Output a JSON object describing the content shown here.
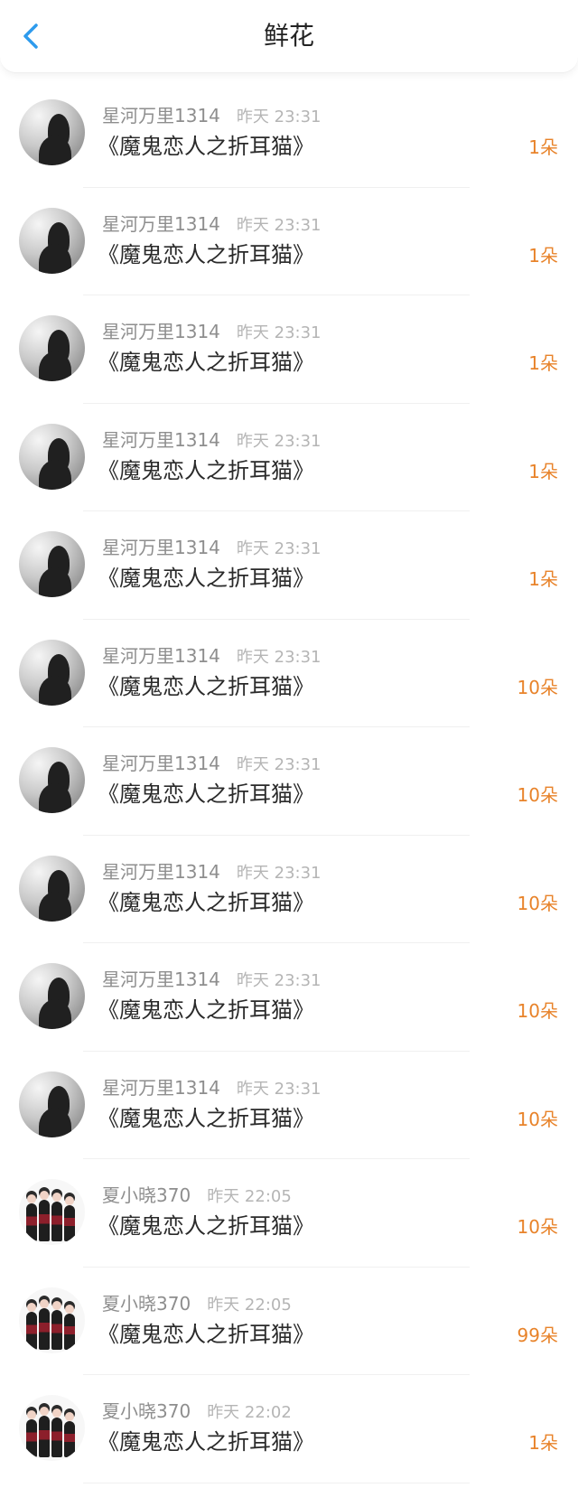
{
  "header": {
    "title": "鲜花",
    "back_icon": "chevron-left-icon",
    "accent_color": "#2e9bed"
  },
  "items": [
    {
      "username": "星河万里1314",
      "time": "昨天 23:31",
      "book": "《魔鬼恋人之折耳猫》",
      "count": "1朵",
      "avatar": "avatar-a"
    },
    {
      "username": "星河万里1314",
      "time": "昨天 23:31",
      "book": "《魔鬼恋人之折耳猫》",
      "count": "1朵",
      "avatar": "avatar-a"
    },
    {
      "username": "星河万里1314",
      "time": "昨天 23:31",
      "book": "《魔鬼恋人之折耳猫》",
      "count": "1朵",
      "avatar": "avatar-a"
    },
    {
      "username": "星河万里1314",
      "time": "昨天 23:31",
      "book": "《魔鬼恋人之折耳猫》",
      "count": "1朵",
      "avatar": "avatar-a"
    },
    {
      "username": "星河万里1314",
      "time": "昨天 23:31",
      "book": "《魔鬼恋人之折耳猫》",
      "count": "1朵",
      "avatar": "avatar-a"
    },
    {
      "username": "星河万里1314",
      "time": "昨天 23:31",
      "book": "《魔鬼恋人之折耳猫》",
      "count": "10朵",
      "avatar": "avatar-a"
    },
    {
      "username": "星河万里1314",
      "time": "昨天 23:31",
      "book": "《魔鬼恋人之折耳猫》",
      "count": "10朵",
      "avatar": "avatar-a"
    },
    {
      "username": "星河万里1314",
      "time": "昨天 23:31",
      "book": "《魔鬼恋人之折耳猫》",
      "count": "10朵",
      "avatar": "avatar-a"
    },
    {
      "username": "星河万里1314",
      "time": "昨天 23:31",
      "book": "《魔鬼恋人之折耳猫》",
      "count": "10朵",
      "avatar": "avatar-a"
    },
    {
      "username": "星河万里1314",
      "time": "昨天 23:31",
      "book": "《魔鬼恋人之折耳猫》",
      "count": "10朵",
      "avatar": "avatar-a"
    },
    {
      "username": "夏小晓370",
      "time": "昨天 22:05",
      "book": "《魔鬼恋人之折耳猫》",
      "count": "10朵",
      "avatar": "avatar-b"
    },
    {
      "username": "夏小晓370",
      "time": "昨天 22:05",
      "book": "《魔鬼恋人之折耳猫》",
      "count": "99朵",
      "avatar": "avatar-b"
    },
    {
      "username": "夏小晓370",
      "time": "昨天 22:02",
      "book": "《魔鬼恋人之折耳猫》",
      "count": "1朵",
      "avatar": "avatar-b"
    }
  ]
}
